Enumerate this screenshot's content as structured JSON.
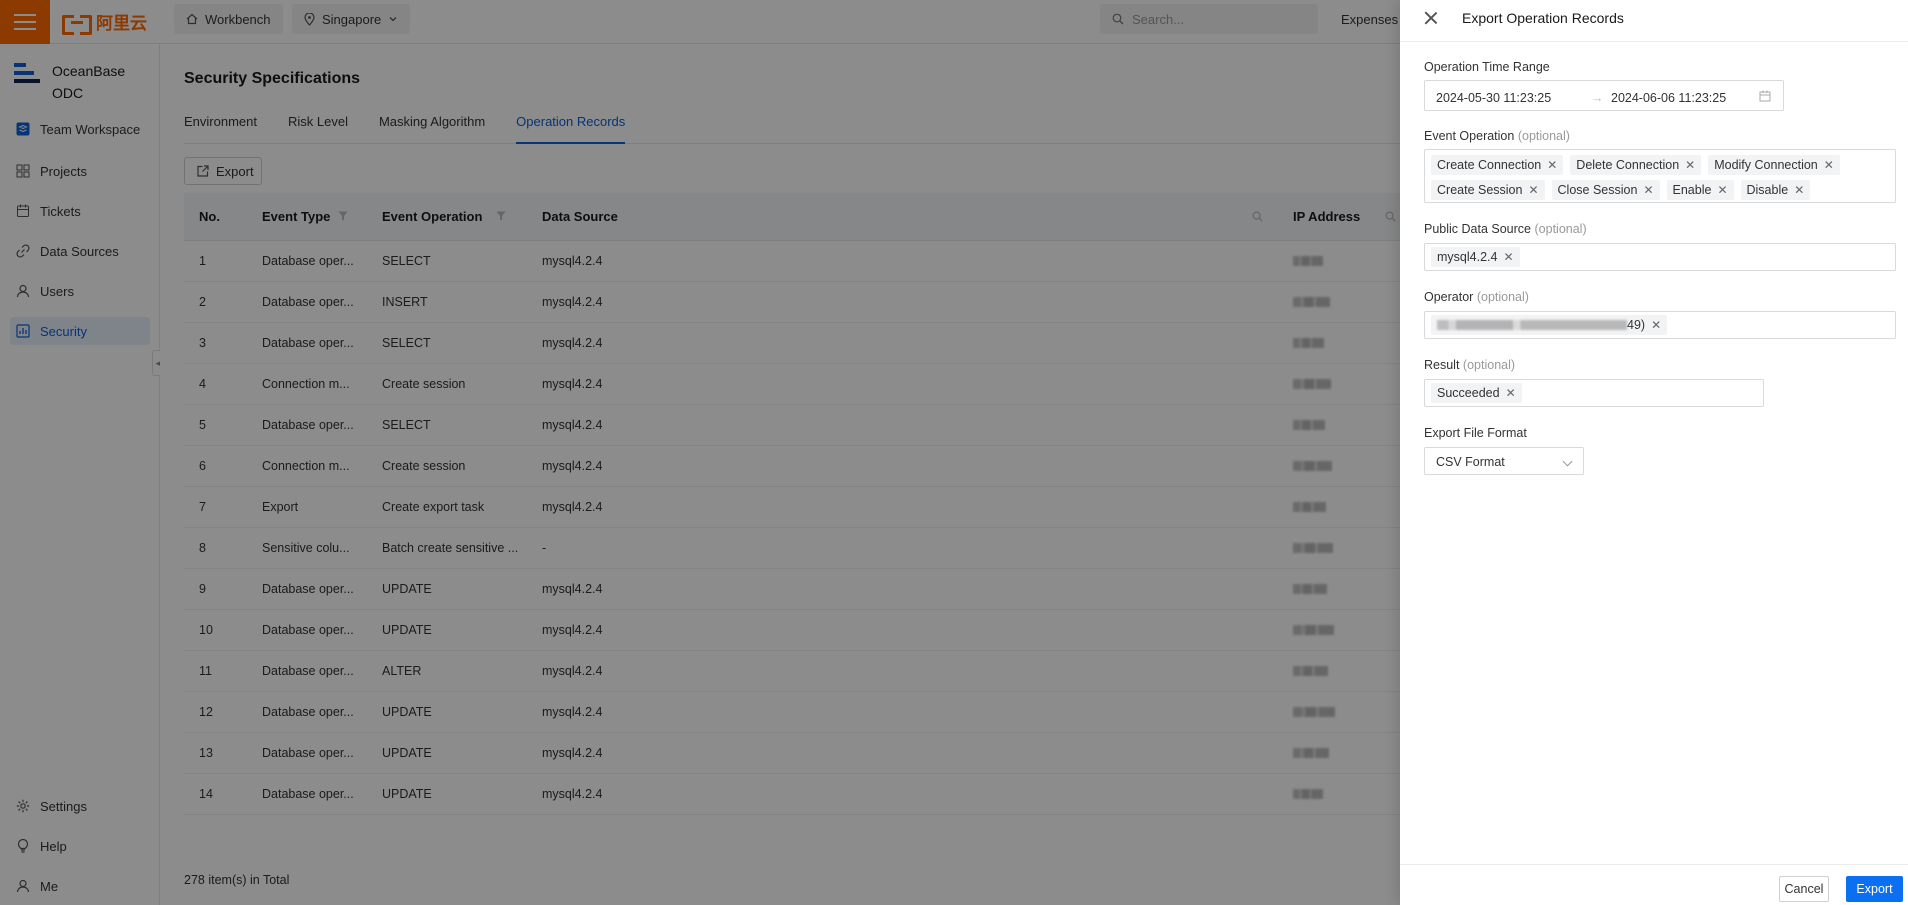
{
  "topbar": {
    "logo_text": "阿里云",
    "workbench": "Workbench",
    "region": "Singapore",
    "search_placeholder": "Search...",
    "expenses": "Expenses"
  },
  "sidebar": {
    "brand_line1": "OceanBase",
    "brand_line2": "ODC",
    "items": [
      {
        "label": "Team Workspace"
      },
      {
        "label": "Projects"
      },
      {
        "label": "Tickets"
      },
      {
        "label": "Data Sources"
      },
      {
        "label": "Users"
      },
      {
        "label": "Security"
      }
    ],
    "bottom": [
      {
        "label": "Settings"
      },
      {
        "label": "Help"
      },
      {
        "label": "Me"
      }
    ]
  },
  "main": {
    "title": "Security Specifications",
    "tabs": [
      {
        "label": "Environment"
      },
      {
        "label": "Risk Level"
      },
      {
        "label": "Masking Algorithm"
      },
      {
        "label": "Operation Records"
      }
    ],
    "export_label": "Export",
    "columns": [
      "No.",
      "Event Type",
      "Event Operation",
      "Data Source",
      "IP Address"
    ],
    "rows": [
      {
        "no": "1",
        "type": "Database oper...",
        "op": "SELECT",
        "ds": "mysql4.2.4"
      },
      {
        "no": "2",
        "type": "Database oper...",
        "op": "INSERT",
        "ds": "mysql4.2.4"
      },
      {
        "no": "3",
        "type": "Database oper...",
        "op": "SELECT",
        "ds": "mysql4.2.4"
      },
      {
        "no": "4",
        "type": "Connection m...",
        "op": "Create session",
        "ds": "mysql4.2.4"
      },
      {
        "no": "5",
        "type": "Database oper...",
        "op": "SELECT",
        "ds": "mysql4.2.4"
      },
      {
        "no": "6",
        "type": "Connection m...",
        "op": "Create session",
        "ds": "mysql4.2.4"
      },
      {
        "no": "7",
        "type": "Export",
        "op": "Create export task",
        "ds": "mysql4.2.4"
      },
      {
        "no": "8",
        "type": "Sensitive colu...",
        "op": "Batch create sensitive ...",
        "ds": "-"
      },
      {
        "no": "9",
        "type": "Database oper...",
        "op": "UPDATE",
        "ds": "mysql4.2.4"
      },
      {
        "no": "10",
        "type": "Database oper...",
        "op": "UPDATE",
        "ds": "mysql4.2.4"
      },
      {
        "no": "11",
        "type": "Database oper...",
        "op": "ALTER",
        "ds": "mysql4.2.4"
      },
      {
        "no": "12",
        "type": "Database oper...",
        "op": "UPDATE",
        "ds": "mysql4.2.4"
      },
      {
        "no": "13",
        "type": "Database oper...",
        "op": "UPDATE",
        "ds": "mysql4.2.4"
      },
      {
        "no": "14",
        "type": "Database oper...",
        "op": "UPDATE",
        "ds": "mysql4.2.4"
      }
    ],
    "total": "278 item(s) in Total"
  },
  "drawer": {
    "title": "Export Operation Records",
    "time_range_label": "Operation Time Range",
    "time_start": "2024-05-30 11:23:25",
    "time_sep": "→",
    "time_end": "2024-06-06 11:23:25",
    "event_op_label": "Event Operation",
    "optional": "(optional)",
    "event_ops": [
      "Create Connection",
      "Delete Connection",
      "Modify Connection",
      "Create Session",
      "Close Session",
      "Enable",
      "Disable"
    ],
    "public_ds_label": "Public Data Source",
    "public_ds": [
      "mysql4.2.4"
    ],
    "operator_label": "Operator",
    "operator_suffix": "49)",
    "result_label": "Result",
    "result": [
      "Succeeded"
    ],
    "format_label": "Export File Format",
    "format_value": "CSV Format",
    "cancel": "Cancel",
    "export": "Export"
  },
  "colors": {
    "accent": "#0b6ff2",
    "brand": "#ff6a00",
    "active_nav_bg": "#e8f1fd"
  }
}
